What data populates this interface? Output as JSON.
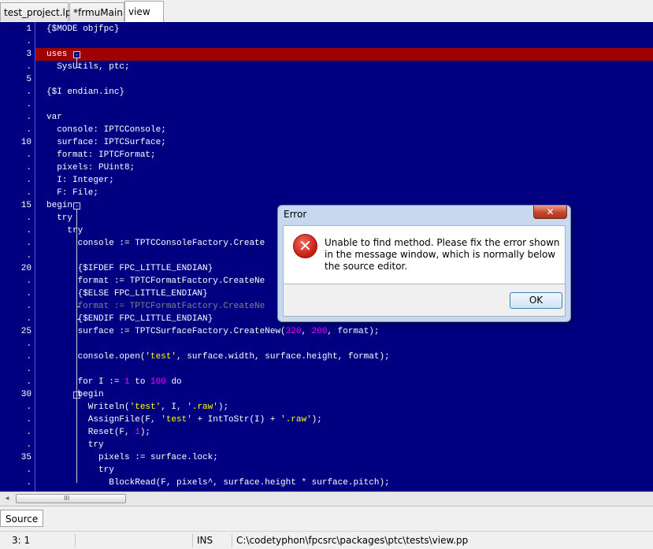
{
  "tabs": [
    {
      "label": "test_project.lpr",
      "active": false
    },
    {
      "label": "*frmuMain",
      "active": false
    },
    {
      "label": "view",
      "active": true
    }
  ],
  "editor": {
    "gutter": [
      "1",
      ".",
      "3",
      ".",
      "5",
      ".",
      ".",
      ".",
      ".",
      "10",
      ".",
      ".",
      ".",
      ".",
      "15",
      ".",
      ".",
      ".",
      ".",
      "20",
      ".",
      ".",
      ".",
      ".",
      "25",
      ".",
      ".",
      ".",
      ".",
      "30",
      ".",
      ".",
      ".",
      ".",
      "35",
      ".",
      "."
    ],
    "lines": [
      "{$MODE objfpc}",
      "",
      "uses",
      "  SysUtils, ptc;",
      "",
      "{$I endian.inc}",
      "",
      "var",
      "  console: IPTCConsole;",
      "  surface: IPTCSurface;",
      "  format: IPTCFormat;",
      "  pixels: PUint8;",
      "  I: Integer;",
      "  F: File;",
      "begin",
      "  try",
      "    try",
      "      console := TPTCConsoleFactory.Create",
      "",
      "      {$IFDEF FPC_LITTLE_ENDIAN}",
      "      format := TPTCFormatFactory.CreateNe",
      "      {$ELSE FPC_LITTLE_ENDIAN}",
      "      format := TPTCFormatFactory.CreateNe",
      "      {$ENDIF FPC_LITTLE_ENDIAN}",
      "      surface := TPTCSurfaceFactory.CreateNew(320, 200, format);",
      "",
      "      console.open('test', surface.width, surface.height, format);",
      "",
      "      for I := 1 to 100 do",
      "      begin",
      "        Writeln('test', I, '.raw');",
      "        AssignFile(F, 'test' + IntToStr(I) + '.raw');",
      "        Reset(F, 1);",
      "        try",
      "          pixels := surface.lock;",
      "          try",
      "            BlockRead(F, pixels^, surface.height * surface.pitch);"
    ],
    "current_line_color": "#a00000",
    "background_color": "#000080"
  },
  "messages": {
    "tab_label": "Source"
  },
  "status": {
    "position": "3:  1",
    "mode": "INS",
    "file_path": "C:\\codetyphon\\fpcsrc\\packages\\ptc\\tests\\view.pp"
  },
  "dialog": {
    "title": "Error",
    "close_label": "✕",
    "icon": "error-icon",
    "message": "Unable to find method. Please fix the error shown in the message window, which is normally below the source editor.",
    "ok_label": "OK"
  },
  "scrollbar": {
    "left_arrow": "◂",
    "grip": "III"
  }
}
